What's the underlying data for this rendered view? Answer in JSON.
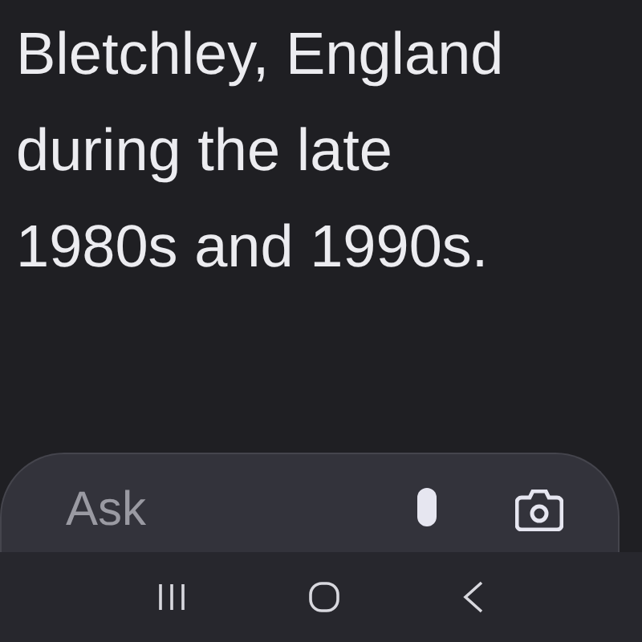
{
  "answer": {
    "text": "Bletchley, England during the late 1980s and 1990s."
  },
  "prompt_bar": {
    "placeholder": "Ask"
  }
}
